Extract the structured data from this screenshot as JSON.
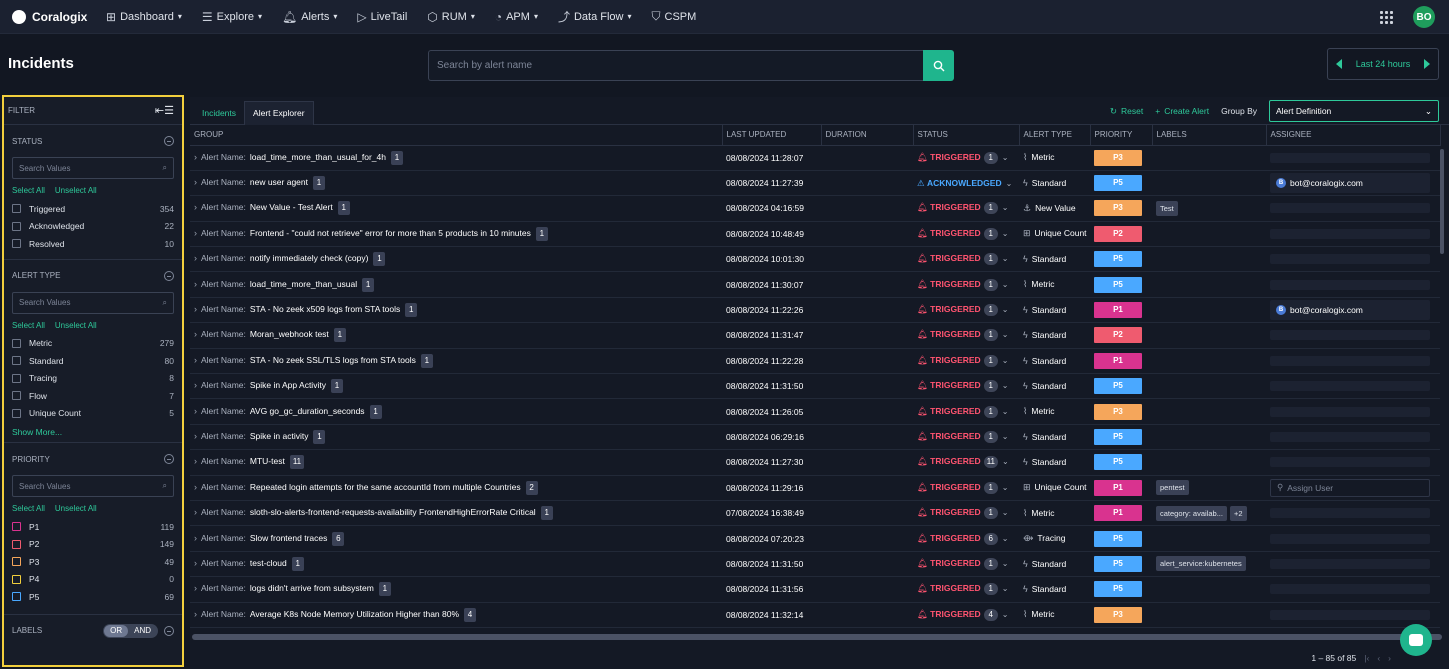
{
  "nav": {
    "brand": "Coralogix",
    "items": [
      {
        "label": "Dashboard",
        "icon": "dashboard-icon",
        "glyph": "⊞",
        "caret": true
      },
      {
        "label": "Explore",
        "icon": "explore-icon",
        "glyph": "☰",
        "caret": true
      },
      {
        "label": "Alerts",
        "icon": "bell-icon",
        "glyph": "🔔︎",
        "caret": true
      },
      {
        "label": "LiveTail",
        "icon": "play-icon",
        "glyph": "▷",
        "caret": false
      },
      {
        "label": "RUM",
        "icon": "cube-icon",
        "glyph": "⬡",
        "caret": true
      },
      {
        "label": "APM",
        "icon": "gauge-icon",
        "glyph": "◔",
        "caret": true
      },
      {
        "label": "Data Flow",
        "icon": "dataflow-icon",
        "glyph": "⤴",
        "caret": true
      },
      {
        "label": "CSPM",
        "icon": "shield-icon",
        "glyph": "⛉",
        "caret": false
      }
    ],
    "avatar": "BO"
  },
  "header": {
    "title": "Incidents",
    "search_placeholder": "Search by alert name",
    "time_range": "Last 24 hours"
  },
  "filter": {
    "title": "FILTER",
    "select_all": "Select All",
    "unselect_all": "Unselect All",
    "search_placeholder": "Search Values",
    "status": {
      "title": "STATUS",
      "options": [
        {
          "label": "Triggered",
          "count": "354"
        },
        {
          "label": "Acknowledged",
          "count": "22"
        },
        {
          "label": "Resolved",
          "count": "10"
        }
      ]
    },
    "alert_type": {
      "title": "ALERT TYPE",
      "options": [
        {
          "label": "Metric",
          "count": "279"
        },
        {
          "label": "Standard",
          "count": "80"
        },
        {
          "label": "Tracing",
          "count": "8"
        },
        {
          "label": "Flow",
          "count": "7"
        },
        {
          "label": "Unique Count",
          "count": "5"
        }
      ],
      "show_more": "Show More..."
    },
    "priority": {
      "title": "PRIORITY",
      "options": [
        {
          "label": "P1",
          "count": "119",
          "color": "#d9338f"
        },
        {
          "label": "P2",
          "count": "149",
          "color": "#ef5b6f"
        },
        {
          "label": "P3",
          "count": "49",
          "color": "#f5a65b"
        },
        {
          "label": "P4",
          "count": "0",
          "color": "#f2cf3d"
        },
        {
          "label": "P5",
          "count": "69",
          "color": "#4aa8ff"
        }
      ]
    },
    "labels": {
      "title": "LABELS",
      "or": "OR",
      "and": "AND"
    }
  },
  "tabs": {
    "incidents": "Incidents",
    "alert_explorer": "Alert Explorer"
  },
  "toolbar": {
    "reset": "Reset",
    "create_alert": "Create Alert",
    "group_by_label": "Group By",
    "group_by_value": "Alert Definition"
  },
  "table": {
    "columns": [
      "GROUP",
      "LAST UPDATED",
      "DURATION",
      "STATUS",
      "ALERT TYPE",
      "PRIORITY",
      "LABELS",
      "ASSIGNEE"
    ],
    "name_prefix": "Alert Name:",
    "rows": [
      {
        "name": "load_time_more_than_usual_for_4h",
        "count": "1",
        "updated": "08/08/2024 11:28:07",
        "status": "TRIGGERED",
        "status_count": "1",
        "type": "Metric",
        "priority": "P3",
        "labels": [],
        "assignee": ""
      },
      {
        "name": "new user agent",
        "count": "1",
        "updated": "08/08/2024 11:27:39",
        "status": "ACKNOWLEDGED",
        "status_count": "",
        "type": "Standard",
        "priority": "P5",
        "labels": [],
        "assignee": "bot@coralogix.com"
      },
      {
        "name": "New Value - Test Alert",
        "count": "1",
        "updated": "08/08/2024 04:16:59",
        "status": "TRIGGERED",
        "status_count": "1",
        "type": "New Value",
        "priority": "P3",
        "labels": [
          "Test"
        ],
        "assignee": ""
      },
      {
        "name": "Frontend - \"could not retrieve\" error for more than 5 products in 10 minutes",
        "count": "1",
        "updated": "08/08/2024 10:48:49",
        "status": "TRIGGERED",
        "status_count": "1",
        "type": "Unique Count",
        "priority": "P2",
        "labels": [],
        "assignee": ""
      },
      {
        "name": "notify immediately check (copy)",
        "count": "1",
        "updated": "08/08/2024 10:01:30",
        "status": "TRIGGERED",
        "status_count": "1",
        "type": "Standard",
        "priority": "P5",
        "labels": [],
        "assignee": ""
      },
      {
        "name": "load_time_more_than_usual",
        "count": "1",
        "updated": "08/08/2024 11:30:07",
        "status": "TRIGGERED",
        "status_count": "1",
        "type": "Metric",
        "priority": "P5",
        "labels": [],
        "assignee": ""
      },
      {
        "name": "STA - No zeek x509 logs from STA tools",
        "count": "1",
        "updated": "08/08/2024 11:22:26",
        "status": "TRIGGERED",
        "status_count": "1",
        "type": "Standard",
        "priority": "P1",
        "labels": [],
        "assignee": "bot@coralogix.com"
      },
      {
        "name": "Moran_webhook test",
        "count": "1",
        "updated": "08/08/2024 11:31:47",
        "status": "TRIGGERED",
        "status_count": "1",
        "type": "Standard",
        "priority": "P2",
        "labels": [],
        "assignee": ""
      },
      {
        "name": "STA - No zeek SSL/TLS logs from STA tools",
        "count": "1",
        "updated": "08/08/2024 11:22:28",
        "status": "TRIGGERED",
        "status_count": "1",
        "type": "Standard",
        "priority": "P1",
        "labels": [],
        "assignee": ""
      },
      {
        "name": "Spike in App Activity",
        "count": "1",
        "updated": "08/08/2024 11:31:50",
        "status": "TRIGGERED",
        "status_count": "1",
        "type": "Standard",
        "priority": "P5",
        "labels": [],
        "assignee": ""
      },
      {
        "name": "AVG go_gc_duration_seconds",
        "count": "1",
        "updated": "08/08/2024 11:26:05",
        "status": "TRIGGERED",
        "status_count": "1",
        "type": "Metric",
        "priority": "P3",
        "labels": [],
        "assignee": ""
      },
      {
        "name": "Spike in activity",
        "count": "1",
        "updated": "08/08/2024 06:29:16",
        "status": "TRIGGERED",
        "status_count": "1",
        "type": "Standard",
        "priority": "P5",
        "labels": [],
        "assignee": ""
      },
      {
        "name": "MTU-test",
        "count": "11",
        "updated": "08/08/2024 11:27:30",
        "status": "TRIGGERED",
        "status_count": "11",
        "type": "Standard",
        "priority": "P5",
        "labels": [],
        "assignee": ""
      },
      {
        "name": "Repeated login attempts for the same accountId from multiple Countries",
        "count": "2",
        "updated": "08/08/2024 11:29:16",
        "status": "TRIGGERED",
        "status_count": "1",
        "type": "Unique Count",
        "priority": "P1",
        "labels": [
          "pentest"
        ],
        "assignee": "Assign User"
      },
      {
        "name": "sloth-slo-alerts-frontend-requests-availability FrontendHighErrorRate Critical",
        "count": "1",
        "updated": "07/08/2024 16:38:49",
        "status": "TRIGGERED",
        "status_count": "1",
        "type": "Metric",
        "priority": "P1",
        "labels": [
          "category: availab...",
          "+2"
        ],
        "assignee": ""
      },
      {
        "name": "Slow frontend traces",
        "count": "6",
        "updated": "08/08/2024 07:20:23",
        "status": "TRIGGERED",
        "status_count": "6",
        "type": "Tracing",
        "priority": "P5",
        "labels": [],
        "assignee": ""
      },
      {
        "name": "test-cloud",
        "count": "1",
        "updated": "08/08/2024 11:31:50",
        "status": "TRIGGERED",
        "status_count": "1",
        "type": "Standard",
        "priority": "P5",
        "labels": [
          "alert_service:kubernetes"
        ],
        "assignee": ""
      },
      {
        "name": "logs didn't arrive from subsystem",
        "count": "1",
        "updated": "08/08/2024 11:31:56",
        "status": "TRIGGERED",
        "status_count": "1",
        "type": "Standard",
        "priority": "P5",
        "labels": [],
        "assignee": ""
      },
      {
        "name": "Average K8s Node Memory Utilization Higher than 80%",
        "count": "4",
        "updated": "08/08/2024 11:32:14",
        "status": "TRIGGERED",
        "status_count": "4",
        "type": "Metric",
        "priority": "P3",
        "labels": [],
        "assignee": ""
      }
    ]
  },
  "pager": "1 – 85 of 85",
  "colors": {
    "accent": "#2ec99a",
    "p1": "#d9338f",
    "p2": "#ef5b6f",
    "p3": "#f5a65b",
    "p5": "#4aa8ff",
    "triggered": "#ff5470",
    "acknowledged": "#4aa8ff"
  }
}
